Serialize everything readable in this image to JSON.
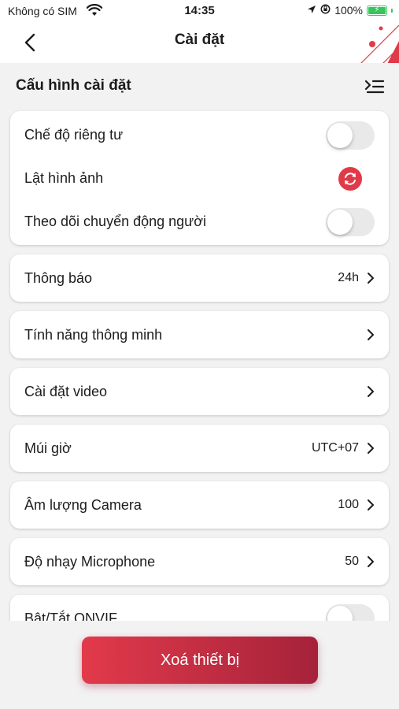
{
  "status_bar": {
    "carrier": "Không có SIM",
    "time": "14:35",
    "battery": "100%",
    "battery_level": 1.0
  },
  "nav": {
    "title": "Cài đặt"
  },
  "section": {
    "title": "Cấu hình cài đặt"
  },
  "toggle_card": {
    "privacy_mode": {
      "label": "Chế độ riêng tư",
      "on": false
    },
    "flip_image": {
      "label": "Lật hình ảnh"
    },
    "motion_tracking": {
      "label": "Theo dõi chuyển động người",
      "on": false
    }
  },
  "rows": {
    "notifications": {
      "label": "Thông báo",
      "value": "24h"
    },
    "smart_features": {
      "label": "Tính năng thông minh"
    },
    "video_settings": {
      "label": "Cài đặt video"
    },
    "timezone": {
      "label": "Múi giờ",
      "value": "UTC+07"
    },
    "camera_volume": {
      "label": "Âm lượng Camera",
      "value": "100"
    },
    "mic_sensitivity": {
      "label": "Độ nhạy Microphone",
      "value": "50"
    },
    "onvif": {
      "label": "Bật/Tắt ONVIF",
      "on": false
    }
  },
  "actions": {
    "delete_device": "Xoá thiết bị"
  },
  "colors": {
    "accent": "#e03a48",
    "accent_dark": "#a5223a",
    "toggle_off": "#e9e9ea",
    "background": "#f2f2f3"
  }
}
